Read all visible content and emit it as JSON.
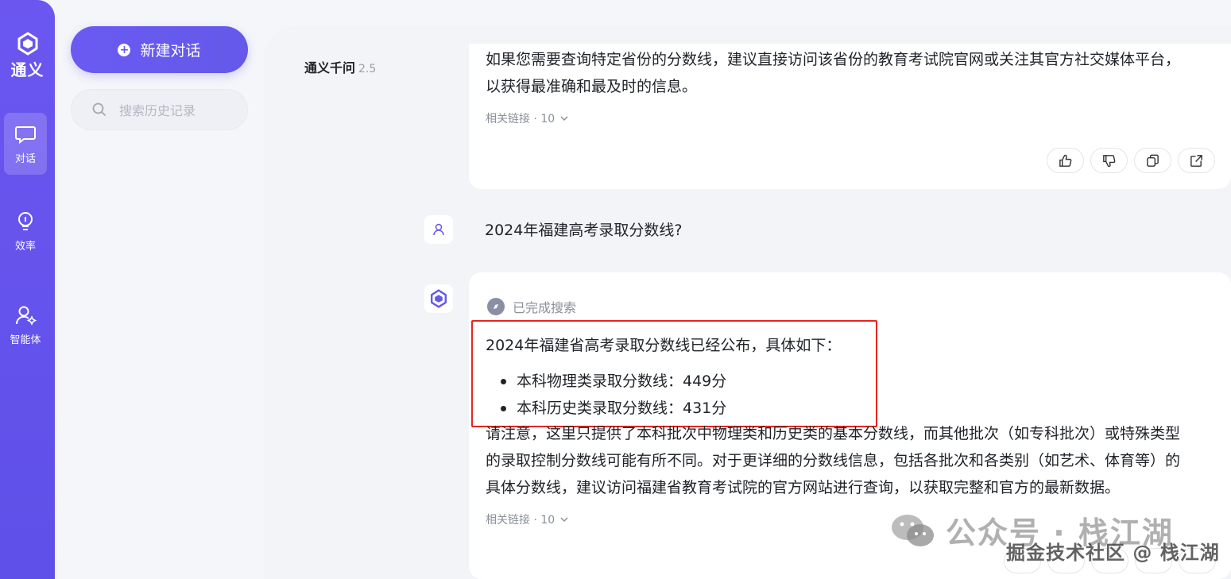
{
  "app": {
    "logo_text": "通义"
  },
  "rail": {
    "items": [
      {
        "label": "对话",
        "icon": "chat-icon",
        "active": true
      },
      {
        "label": "效率",
        "icon": "bulb-icon",
        "active": false
      },
      {
        "label": "智能体",
        "icon": "agent-icon",
        "active": false
      }
    ]
  },
  "panel": {
    "new_chat_label": "新建对话",
    "search_placeholder": "搜索历史记录"
  },
  "main": {
    "brand": "通义千问",
    "version": "2.5",
    "answer1": {
      "line1": "如果您需要查询特定省份的分数线，建议直接访问该省份的教育考试院官网或关注其官方社交媒体平台，",
      "line2": "以获得最准确和最及时的信息。",
      "links": "相关链接 · 10"
    },
    "user_question": "2024年福建高考录取分数线?",
    "answer2": {
      "status": "已完成搜索",
      "intro": "2024年福建省高考录取分数线已经公布，具体如下：",
      "bullets": [
        "本科物理类录取分数线：449分",
        "本科历史类录取分数线：431分"
      ],
      "note_line1": "请注意，这里只提供了本科批次中物理类和历史类的基本分数线，而其他批次（如专科批次）或特殊类型",
      "note_line2": "的录取控制分数线可能有所不同。对于更详细的分数线信息，包括各批次和各类别（如艺术、体育等）的",
      "note_line3": "具体分数线，建议访问福建省教育考试院的官方网站进行查询，以获取完整和官方的最新数据。",
      "links": "相关链接 · 10"
    }
  },
  "watermark": {
    "line1": "公众号 · 栈江湖",
    "line2": "掘金技术社区 @ 栈江湖"
  },
  "colors": {
    "accent": "#6459e9",
    "highlight_border": "#e3261f"
  }
}
